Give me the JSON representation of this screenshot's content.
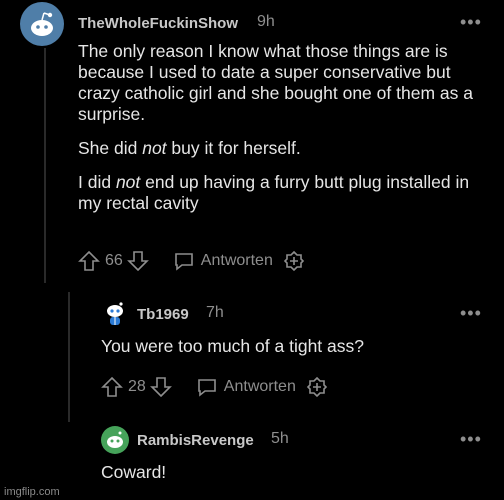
{
  "comments": [
    {
      "username": "TheWholeFuckinShow",
      "time": "9h",
      "more": "•••",
      "paragraphs": [
        {
          "parts": [
            {
              "text": "The only reason I know what those things are is because I used to date a super conservative but crazy catholic girl and she bought one of them as a surprise."
            }
          ]
        },
        {
          "parts": [
            {
              "text": "She did "
            },
            {
              "text": "not",
              "em": true
            },
            {
              "text": " buy it for herself."
            }
          ]
        },
        {
          "parts": [
            {
              "text": "I did "
            },
            {
              "text": "not",
              "em": true
            },
            {
              "text": " end up having a furry butt plug installed in my rectal cavity"
            }
          ]
        }
      ],
      "votes": "66",
      "reply_label": "Antworten"
    },
    {
      "username": "Tb1969",
      "time": "7h",
      "more": "•••",
      "text": "You were too much of a tight ass?",
      "votes": "28",
      "reply_label": "Antworten"
    },
    {
      "username": "RambisRevenge",
      "time": "5h",
      "more": "•••",
      "text": "Coward!"
    }
  ],
  "watermark": "imgflip.com",
  "colors": {
    "background": "#000000",
    "avatar_1": "#4f7ea8",
    "avatar_2": "#ffffff",
    "avatar_3": "#46a35a"
  }
}
